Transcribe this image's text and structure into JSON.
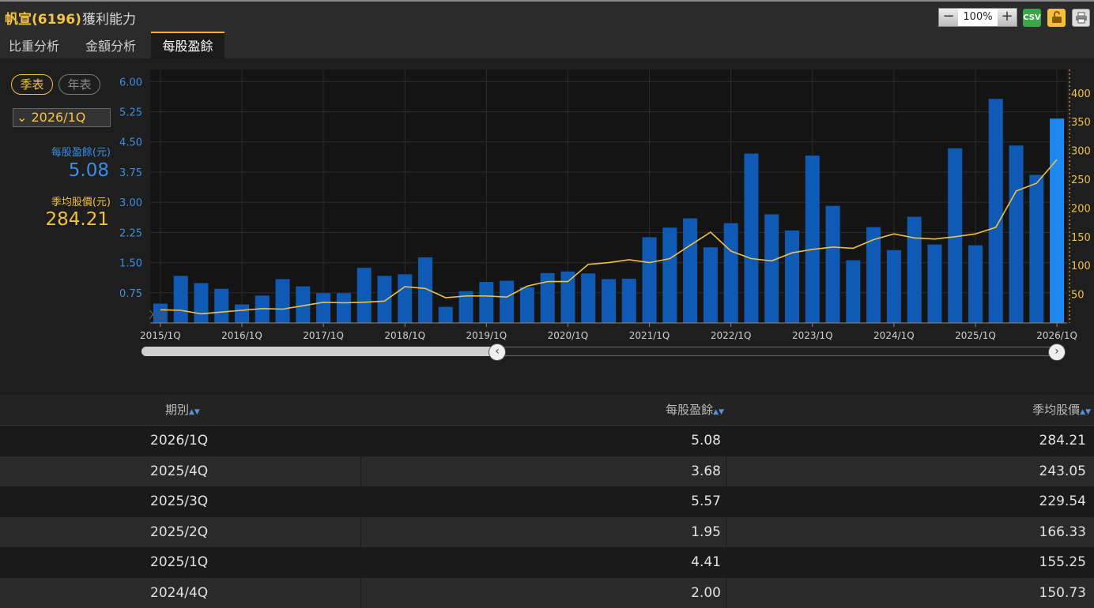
{
  "header": {
    "code": "帆宣(6196)",
    "title": "獲利能力"
  },
  "toolbar": {
    "zoom_minus": "−",
    "zoom_value": "100%",
    "zoom_plus": "+",
    "csv_label": "CSV"
  },
  "tabs": [
    {
      "label": "比重分析"
    },
    {
      "label": "金額分析"
    },
    {
      "label": "每股盈餘"
    }
  ],
  "period_toggle": {
    "quarterly": "季表",
    "yearly": "年表"
  },
  "selected_period": "2026/1Q",
  "summary": {
    "eps_label": "每股盈餘(元)",
    "eps_value": "5.08",
    "price_label": "季均股價(元)",
    "price_value": "284.21"
  },
  "watermark": "XQ",
  "colors": {
    "bar": "#0f5ab5",
    "bar_highlight": "#1e88f0",
    "line": "#f0c040",
    "left_axis": "#3a8ee6",
    "right_axis": "#f0c040"
  },
  "chart_data": {
    "type": "bar",
    "categories": [
      "2015/1Q",
      "2015/2Q",
      "2015/3Q",
      "2015/4Q",
      "2016/1Q",
      "2016/2Q",
      "2016/3Q",
      "2016/4Q",
      "2017/1Q",
      "2017/2Q",
      "2017/3Q",
      "2017/4Q",
      "2018/1Q",
      "2018/2Q",
      "2018/3Q",
      "2018/4Q",
      "2019/1Q",
      "2019/2Q",
      "2019/3Q",
      "2019/4Q",
      "2020/1Q",
      "2020/2Q",
      "2020/3Q",
      "2020/4Q",
      "2021/1Q",
      "2021/2Q",
      "2021/3Q",
      "2021/4Q",
      "2022/1Q",
      "2022/2Q",
      "2022/3Q",
      "2022/4Q",
      "2023/1Q",
      "2023/2Q",
      "2023/3Q",
      "2023/4Q",
      "2024/1Q",
      "2024/2Q",
      "2024/3Q",
      "2024/4Q",
      "2025/1Q",
      "2025/2Q",
      "2025/3Q",
      "2025/4Q",
      "2026/1Q"
    ],
    "x_tick_labels": [
      "2015/1Q",
      "2016/1Q",
      "2017/1Q",
      "2018/1Q",
      "2019/1Q",
      "2020/1Q",
      "2021/1Q",
      "2022/1Q",
      "2023/1Q",
      "2024/1Q",
      "2025/1Q",
      "2026/1Q"
    ],
    "series": [
      {
        "name": "每股盈餘(元)",
        "type": "bar",
        "axis": "left",
        "values": [
          0.48,
          1.17,
          0.99,
          0.85,
          0.46,
          0.68,
          1.09,
          0.91,
          0.74,
          0.74,
          1.37,
          1.17,
          1.21,
          1.63,
          0.4,
          0.79,
          1.02,
          1.05,
          0.89,
          1.24,
          1.28,
          1.23,
          1.09,
          1.1,
          2.13,
          2.37,
          2.6,
          1.88,
          2.48,
          4.21,
          2.7,
          2.3,
          4.16,
          2.91,
          1.56,
          2.38,
          1.81,
          2.64,
          1.95,
          4.34,
          1.93,
          5.57,
          4.41,
          3.68,
          5.08
        ]
      },
      {
        "name": "季均股價(元)",
        "type": "line",
        "axis": "right",
        "values": [
          23,
          22,
          16,
          19,
          22,
          25,
          24,
          30,
          36,
          35,
          36,
          38,
          63,
          60,
          44,
          47,
          47,
          45,
          64,
          72,
          72,
          102,
          105,
          110,
          105,
          112,
          135,
          158,
          125,
          112,
          108,
          122,
          128,
          132,
          130,
          145,
          155,
          148,
          146,
          150,
          155,
          166.33,
          229.54,
          243.05,
          284.21
        ]
      }
    ],
    "left_axis": {
      "ylim": [
        0,
        6.3
      ],
      "ticks": [
        "0.75",
        "1.50",
        "2.25",
        "3.00",
        "3.75",
        "4.50",
        "5.25",
        "6.00"
      ]
    },
    "right_axis": {
      "ylim": [
        0,
        441
      ],
      "ticks": [
        "50",
        "100",
        "150",
        "200",
        "250",
        "300",
        "350",
        "400"
      ]
    },
    "grid": true
  },
  "table": {
    "headers": {
      "period": "期別",
      "eps": "每股盈餘",
      "price": "季均股價"
    },
    "rows": [
      {
        "period": "2026/1Q",
        "eps": "5.08",
        "price": "284.21"
      },
      {
        "period": "2025/4Q",
        "eps": "3.68",
        "price": "243.05"
      },
      {
        "period": "2025/3Q",
        "eps": "5.57",
        "price": "229.54"
      },
      {
        "period": "2025/2Q",
        "eps": "1.95",
        "price": "166.33"
      },
      {
        "period": "2025/1Q",
        "eps": "4.41",
        "price": "155.25"
      },
      {
        "period": "2024/4Q",
        "eps": "2.00",
        "price": "150.73"
      }
    ]
  }
}
